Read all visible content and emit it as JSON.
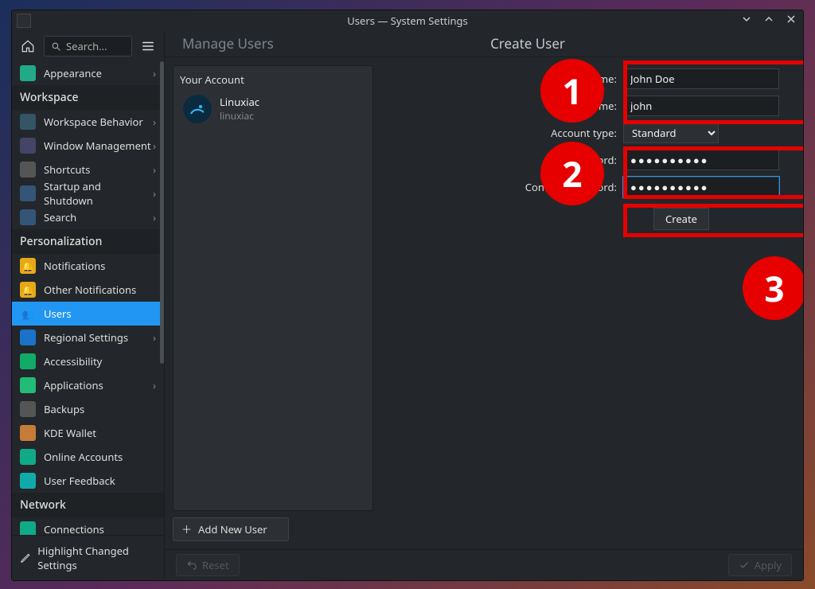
{
  "window": {
    "title": "Users — System Settings"
  },
  "search": {
    "placeholder": "Search..."
  },
  "sidebar": {
    "items": [
      {
        "label": "Appearance",
        "chev": true
      },
      {
        "header": "Workspace"
      },
      {
        "label": "Workspace Behavior",
        "chev": true
      },
      {
        "label": "Window Management",
        "chev": true
      },
      {
        "label": "Shortcuts",
        "chev": true
      },
      {
        "label": "Startup and Shutdown",
        "chev": true
      },
      {
        "label": "Search",
        "chev": true
      },
      {
        "header": "Personalization"
      },
      {
        "label": "Notifications"
      },
      {
        "label": "Other Notifications"
      },
      {
        "label": "Users",
        "active": true
      },
      {
        "label": "Regional Settings",
        "chev": true
      },
      {
        "label": "Accessibility"
      },
      {
        "label": "Applications",
        "chev": true
      },
      {
        "label": "Backups"
      },
      {
        "label": "KDE Wallet"
      },
      {
        "label": "Online Accounts"
      },
      {
        "label": "User Feedback"
      },
      {
        "header": "Network"
      },
      {
        "label": "Connections"
      }
    ],
    "highlight": "Highlight Changed Settings"
  },
  "content": {
    "manage_header": "Manage Users",
    "create_header": "Create User",
    "your_account": "Your Account",
    "user": {
      "name": "Linuxiac",
      "username": "linuxiac"
    },
    "add_new_user": "Add New User",
    "form": {
      "name_label": "Name:",
      "name_value": "John Doe",
      "username_label": "Username:",
      "username_value": "john",
      "account_type_label": "Account type:",
      "account_type_value": "Standard",
      "password_label": "Password:",
      "password_value": "●●●●●●●●●●",
      "confirm_label": "Confirm password:",
      "confirm_value": "●●●●●●●●●●",
      "create_button": "Create"
    }
  },
  "footer": {
    "reset": "Reset",
    "apply": "Apply"
  },
  "annotations": {
    "b1": "1",
    "b2": "2",
    "b3": "3"
  }
}
